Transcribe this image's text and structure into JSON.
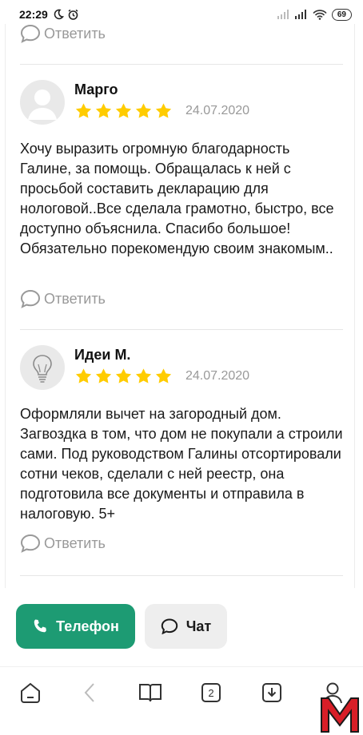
{
  "status_bar": {
    "time": "22:29",
    "battery": "69",
    "icons": [
      "moon-icon",
      "alarm-icon",
      "signal-icon",
      "signal-icon",
      "wifi-icon",
      "battery-icon"
    ]
  },
  "reply_label": "Ответить",
  "reviews": [
    {
      "author": "Марго",
      "rating": 5,
      "date": "24.07.2020",
      "avatar_icon": "user-silhouette-icon",
      "text": "Хочу выразить огромную благодарность Галине, за помощь. Обращалась к ней с просьбой составить декларацию для нологовой..Все сделала грамотно, быстро, все доступно объяснила. Спасибо большое! Обязательно порекомендую своим знакомым.."
    },
    {
      "author": "Идеи М.",
      "rating": 5,
      "date": "24.07.2020",
      "avatar_icon": "lightbulb-icon",
      "text": "Оформляли вычет на загородный дом. Загвоздка в том, что дом не покупали а строили сами. Под руководством Галины отсортировали сотни чеков, сделали с ней реестр, она подготовила все документы и отправила в налоговую. 5+"
    }
  ],
  "actions": {
    "phone_label": "Телефон",
    "chat_label": "Чат"
  },
  "browser_nav": {
    "tabs_count": "2",
    "items": [
      "home-icon",
      "back-icon",
      "book-icon",
      "tabs-icon",
      "download-icon",
      "profile-icon"
    ]
  },
  "colors": {
    "star": "#ffcc00",
    "phone_button": "#1d9b73",
    "chat_button": "#eeeeee",
    "muted_text": "#999999",
    "logo_red": "#d81e27"
  }
}
